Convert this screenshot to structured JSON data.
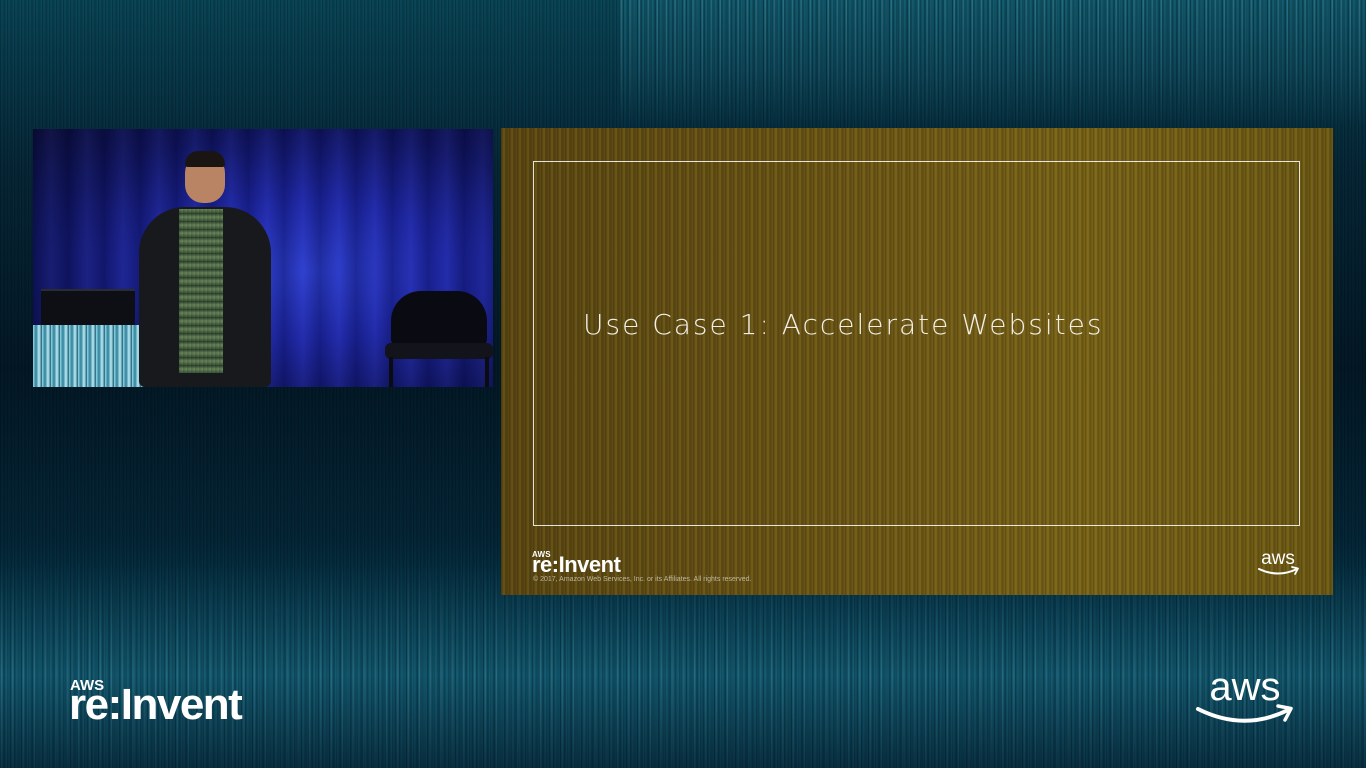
{
  "slide": {
    "title": "Use Case 1: Accelerate Websites",
    "logo": {
      "aws_small": "AWS",
      "reinvent": "re:Invent"
    },
    "copyright": "© 2017, Amazon Web Services, Inc. or its Affiliates. All rights reserved.",
    "brand_logo": "aws"
  },
  "overlay": {
    "reinvent_logo": {
      "aws_small": "AWS",
      "reinvent": "re:Invent"
    },
    "brand_logo": "aws"
  },
  "video_feed": {
    "scene": "speaker-on-stage"
  },
  "colors": {
    "slide_background": "#6d5716",
    "stage_background": "#031a28",
    "text": "#ffffff"
  }
}
